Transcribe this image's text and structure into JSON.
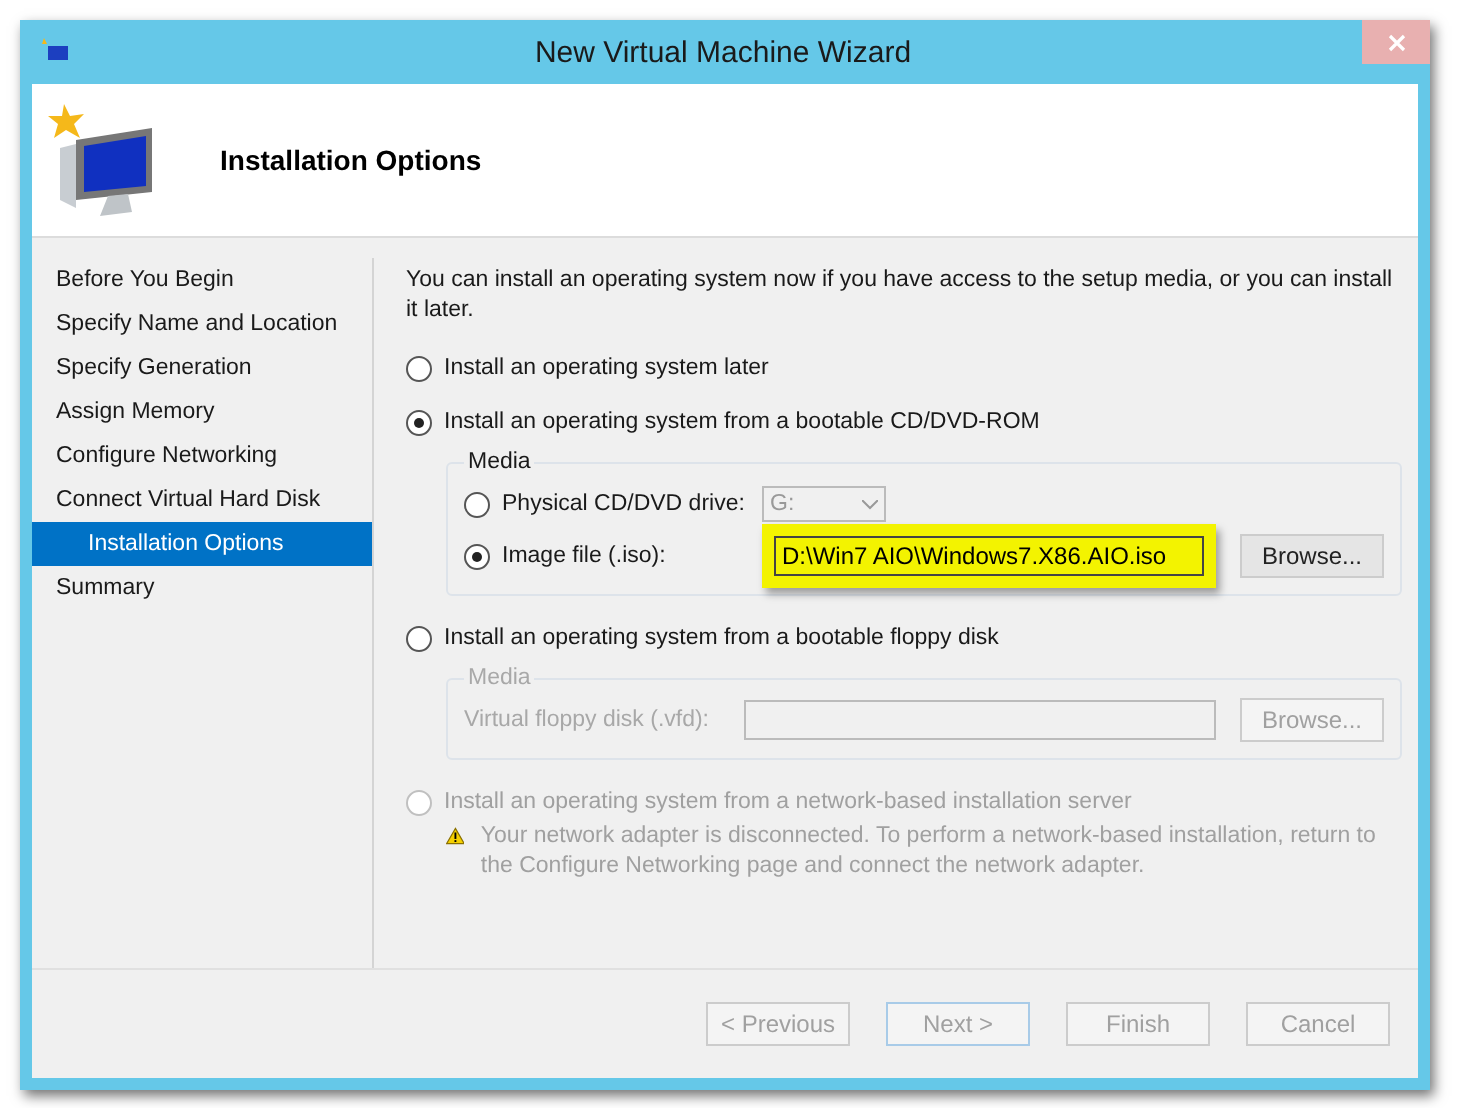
{
  "window": {
    "title": "New Virtual Machine Wizard"
  },
  "header": {
    "title": "Installation Options"
  },
  "steps": [
    {
      "label": "Before You Begin",
      "selected": false
    },
    {
      "label": "Specify Name and Location",
      "selected": false
    },
    {
      "label": "Specify Generation",
      "selected": false
    },
    {
      "label": "Assign Memory",
      "selected": false
    },
    {
      "label": "Configure Networking",
      "selected": false
    },
    {
      "label": "Connect Virtual Hard Disk",
      "selected": false
    },
    {
      "label": "Installation Options",
      "selected": true
    },
    {
      "label": "Summary",
      "selected": false
    }
  ],
  "intro": "You can install an operating system now if you have access to the setup media, or you can install it later.",
  "options": [
    {
      "label": "Install an operating system later",
      "selected": false,
      "disabled": false
    },
    {
      "label": "Install an operating system from a bootable CD/DVD-ROM",
      "selected": true,
      "disabled": false,
      "media": {
        "title": "Media",
        "disabled": false,
        "rows": [
          {
            "kind": "drive",
            "label": "Physical CD/DVD drive:",
            "selected": false,
            "value": "G:"
          },
          {
            "kind": "file",
            "label": "Image file (.iso):",
            "selected": true,
            "value": "D:\\Win7 AIO\\Windows7.X86.AIO.iso",
            "button": "Browse...",
            "highlighted": true
          }
        ]
      }
    },
    {
      "label": "Install an operating system from a bootable floppy disk",
      "selected": false,
      "disabled": false,
      "media": {
        "title": "Media",
        "disabled": true,
        "rows": [
          {
            "kind": "plain-file",
            "label": "Virtual floppy disk (.vfd):",
            "button": "Browse...",
            "highlighted": false
          }
        ]
      }
    },
    {
      "label": "Install an operating system from a network-based installation server",
      "selected": false,
      "disabled": true,
      "warning": "Your network adapter is disconnected. To perform a network-based installation, return to the Configure Networking page and connect the network adapter."
    }
  ],
  "buttons": [
    {
      "label": "< Previous",
      "disabled": true,
      "default": false
    },
    {
      "label": "Next >",
      "disabled": true,
      "default": true
    },
    {
      "label": "Finish",
      "disabled": true,
      "default": false
    },
    {
      "label": "Cancel",
      "disabled": true,
      "default": false
    }
  ]
}
